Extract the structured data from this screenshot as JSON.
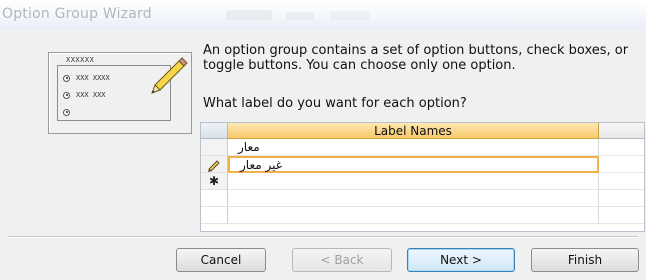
{
  "window": {
    "title": "Option Group Wizard"
  },
  "preview": {
    "caption": "XXXXXX",
    "options": [
      {
        "label": "XXX XXXX",
        "selected": true
      },
      {
        "label": "XXX XXX",
        "selected": true
      },
      {
        "label": "",
        "selected": false
      }
    ]
  },
  "instructions": {
    "description": "An option group contains a set of option buttons, check boxes, or toggle buttons. You can choose only one option.",
    "prompt": "What label do you want for each option?"
  },
  "grid": {
    "column_header": "Label Names",
    "rows": [
      {
        "selector": "",
        "value": "معار"
      },
      {
        "selector": "pencil-icon",
        "value": "غير معار"
      },
      {
        "selector": "new-row-icon",
        "value": ""
      }
    ]
  },
  "buttons": {
    "cancel": {
      "label": "Cancel",
      "enabled": true
    },
    "back": {
      "label": "< Back",
      "enabled": false
    },
    "next": {
      "label": "Next >",
      "enabled": true
    },
    "finish": {
      "label": "Finish",
      "enabled": true
    }
  }
}
